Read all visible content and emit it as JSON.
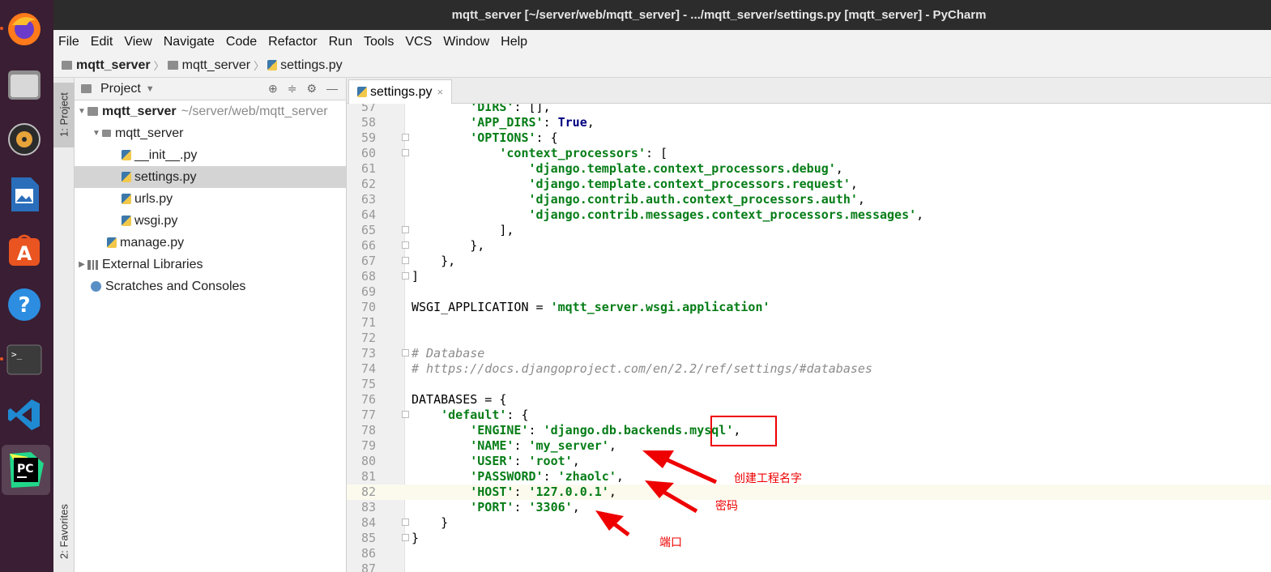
{
  "window": {
    "title": "mqtt_server [~/server/web/mqtt_server] - .../mqtt_server/settings.py [mqtt_server] - PyCharm"
  },
  "dock": {
    "items": [
      {
        "name": "firefox-icon"
      },
      {
        "name": "files-icon"
      },
      {
        "name": "rhythmbox-icon"
      },
      {
        "name": "libreoffice-writer-icon"
      },
      {
        "name": "software-center-icon"
      },
      {
        "name": "help-icon"
      },
      {
        "name": "terminal-icon"
      },
      {
        "name": "vscode-icon"
      },
      {
        "name": "pycharm-icon"
      }
    ]
  },
  "menu": [
    "File",
    "Edit",
    "View",
    "Navigate",
    "Code",
    "Refactor",
    "Run",
    "Tools",
    "VCS",
    "Window",
    "Help"
  ],
  "breadcrumb": [
    "mqtt_server",
    "mqtt_server",
    "settings.py"
  ],
  "toolstrip": {
    "project_tab": "1: Project",
    "favorites_tab": "2: Favorites"
  },
  "project_panel": {
    "title": "Project",
    "tree": [
      {
        "label": "mqtt_server",
        "hint": "~/server/web/mqtt_server"
      },
      {
        "label": "mqtt_server"
      },
      {
        "label": "__init__.py"
      },
      {
        "label": "settings.py"
      },
      {
        "label": "urls.py"
      },
      {
        "label": "wsgi.py"
      },
      {
        "label": "manage.py"
      },
      {
        "label": "External Libraries"
      },
      {
        "label": "Scratches and Consoles"
      }
    ]
  },
  "editor": {
    "tab": "settings.py",
    "lines": [
      {
        "n": "57",
        "t": "        'DIRS': [],"
      },
      {
        "n": "58",
        "t": "        'APP_DIRS': True,"
      },
      {
        "n": "59",
        "t": "        'OPTIONS': {"
      },
      {
        "n": "60",
        "t": "            'context_processors': ["
      },
      {
        "n": "61",
        "t": "                'django.template.context_processors.debug',"
      },
      {
        "n": "62",
        "t": "                'django.template.context_processors.request',"
      },
      {
        "n": "63",
        "t": "                'django.contrib.auth.context_processors.auth',"
      },
      {
        "n": "64",
        "t": "                'django.contrib.messages.context_processors.messages',"
      },
      {
        "n": "65",
        "t": "            ],"
      },
      {
        "n": "66",
        "t": "        },"
      },
      {
        "n": "67",
        "t": "    },"
      },
      {
        "n": "68",
        "t": "]"
      },
      {
        "n": "69",
        "t": ""
      },
      {
        "n": "70",
        "t": "WSGI_APPLICATION = 'mqtt_server.wsgi.application'"
      },
      {
        "n": "71",
        "t": ""
      },
      {
        "n": "72",
        "t": ""
      },
      {
        "n": "73",
        "t": "# Database"
      },
      {
        "n": "74",
        "t": "# https://docs.djangoproject.com/en/2.2/ref/settings/#databases"
      },
      {
        "n": "75",
        "t": ""
      },
      {
        "n": "76",
        "t": "DATABASES = {"
      },
      {
        "n": "77",
        "t": "    'default': {"
      },
      {
        "n": "78",
        "t": "        'ENGINE': 'django.db.backends.mysql',"
      },
      {
        "n": "79",
        "t": "        'NAME': 'my_server',"
      },
      {
        "n": "80",
        "t": "        'USER': 'root',"
      },
      {
        "n": "81",
        "t": "        'PASSWORD': 'zhaolc',"
      },
      {
        "n": "82",
        "t": "        'HOST': '127.0.0.1',"
      },
      {
        "n": "83",
        "t": "        'PORT': '3306',"
      },
      {
        "n": "84",
        "t": "    }"
      },
      {
        "n": "85",
        "t": "}"
      },
      {
        "n": "86",
        "t": ""
      },
      {
        "n": "87",
        "t": ""
      }
    ]
  },
  "annotations": {
    "project_name": "创建工程名字",
    "password": "密码",
    "port": "端口"
  },
  "colors": {
    "dock_bg": "#3a1e33",
    "titlebar_bg": "#2c2c2c",
    "string": "#067d17",
    "keyword": "#000080",
    "annotation": "#e00000"
  }
}
